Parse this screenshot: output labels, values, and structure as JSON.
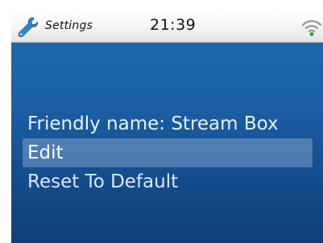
{
  "statusbar": {
    "app_icon": "wrench-icon",
    "app_name": "Settings",
    "time": "21:39",
    "signal_icon": "wifi-icon"
  },
  "menu": {
    "items": [
      {
        "label": "Friendly name: Stream Box",
        "selected": false
      },
      {
        "label": "Edit",
        "selected": true
      },
      {
        "label": "Reset To Default",
        "selected": false
      }
    ]
  },
  "colors": {
    "background_top": "#1d6cb6",
    "background_bottom": "#0f3f78",
    "highlight": "#8fa8cc",
    "text": "#dbe8f6"
  }
}
